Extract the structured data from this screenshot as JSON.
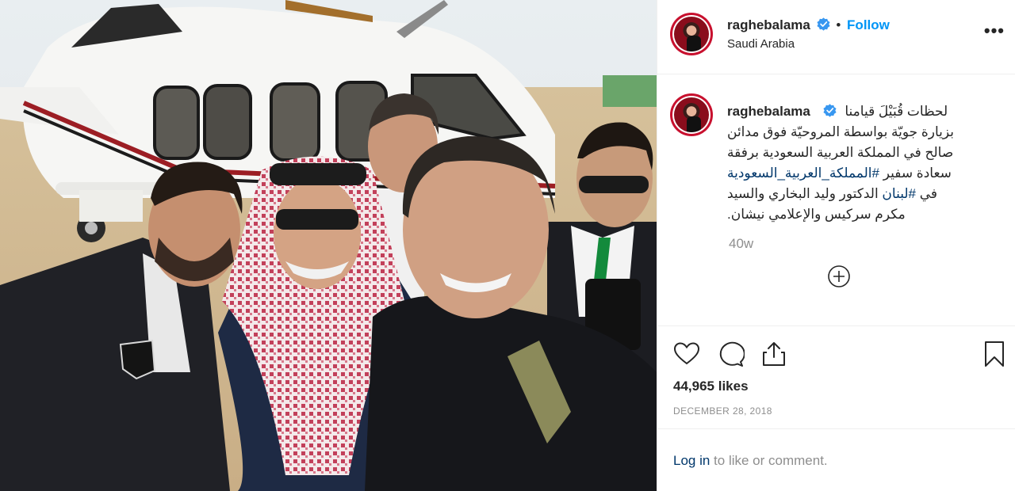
{
  "post": {
    "image_alt": "Group selfie in front of a helicopter in the desert",
    "header": {
      "username": "raghebalama",
      "separator": "•",
      "follow_label": "Follow",
      "location": "Saudi Arabia",
      "more_icon": "more-options-icon"
    },
    "caption": {
      "username": "raghebalama",
      "lines": [
        "لحظات قُبَيْلَ قيامنا",
        "بزيارة جويّة بواسطة المروحيّة فوق مدائن",
        "صالح في المملكة العربية السعودية برفقة",
        "سعادة سفير",
        "في",
        "الدكتور وليد البخاري والسيد",
        "مكرم سركيس والإعلامي نيشان."
      ],
      "hashtag_1": "#المملكة_العربية_السعودية",
      "hashtag_2": "#لبنان",
      "time_ago": "40w"
    },
    "actions": {
      "likes": "44,965 likes",
      "date": "DECEMBER 28, 2018"
    },
    "login": {
      "link": "Log in",
      "rest": " to like or comment."
    }
  },
  "colors": {
    "link_blue": "#0095f6",
    "hashtag": "#00376b",
    "muted": "#8e8e8e",
    "avatar_ring": "#c8102e"
  }
}
